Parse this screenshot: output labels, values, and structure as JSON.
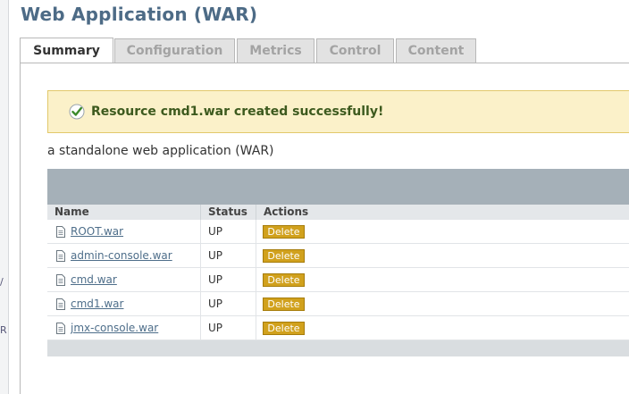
{
  "page": {
    "title": "Web Application (WAR)"
  },
  "left_rail": {
    "fragments": [
      "/",
      "R"
    ]
  },
  "tabs": [
    {
      "label": "Summary",
      "active": true
    },
    {
      "label": "Configuration",
      "active": false
    },
    {
      "label": "Metrics",
      "active": false
    },
    {
      "label": "Control",
      "active": false
    },
    {
      "label": "Content",
      "active": false
    }
  ],
  "message": {
    "icon": "check-circle-icon",
    "text": "Resource cmd1.war created successfully!"
  },
  "description": "a standalone web application (WAR)",
  "table": {
    "headers": {
      "name": "Name",
      "status": "Status",
      "actions": "Actions"
    },
    "rows": [
      {
        "name": "ROOT.war",
        "status": "UP",
        "action": "Delete"
      },
      {
        "name": "admin-console.war",
        "status": "UP",
        "action": "Delete"
      },
      {
        "name": "cmd.war",
        "status": "UP",
        "action": "Delete"
      },
      {
        "name": "cmd1.war",
        "status": "UP",
        "action": "Delete"
      },
      {
        "name": "jmx-console.war",
        "status": "UP",
        "action": "Delete"
      }
    ]
  },
  "colors": {
    "title": "#4d6b86",
    "message_bg": "#fbf1c9",
    "message_text": "#3d5a1e",
    "table_header_bar": "#a5b0b8",
    "delete_button": "#d1a11d",
    "link": "#4e6e8a"
  }
}
